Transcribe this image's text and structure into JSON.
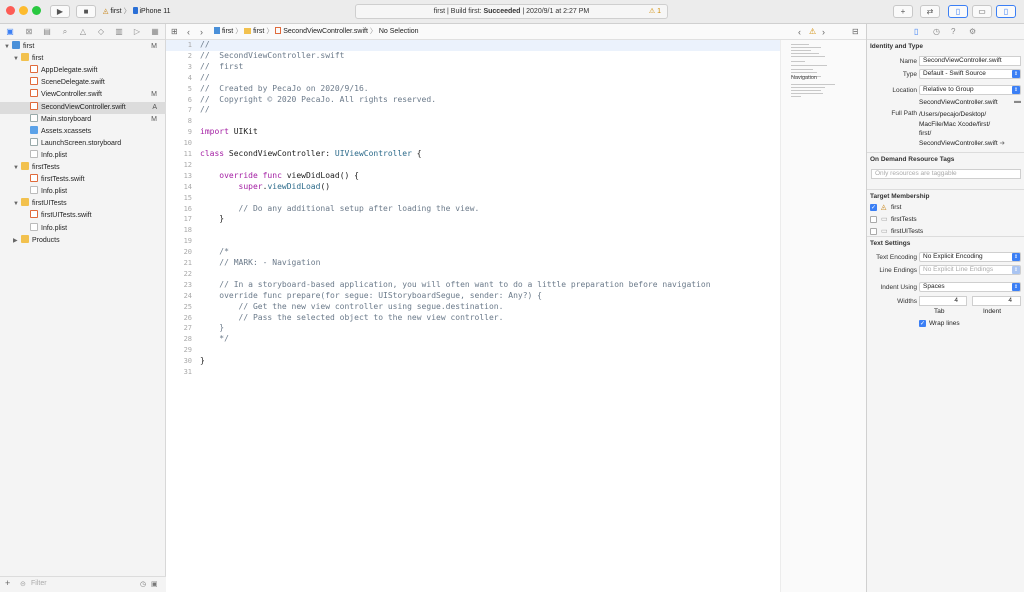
{
  "toolbar": {
    "scheme": "first",
    "device": "iPhone 11",
    "activity": "first | Build first: Succeeded | 2020/9/1 at 2:27 PM",
    "activity_prefix": "first | Build first: ",
    "activity_status": "Succeeded",
    "activity_suffix": " | 2020/9/1 at 2:27 PM",
    "warning_count": "1",
    "colors": {
      "close": "#fd5c55",
      "minimize": "#fdbb2e",
      "zoom": "#29c840",
      "accent": "#3b7ff5"
    }
  },
  "navigator": {
    "tree": [
      {
        "label": "first",
        "icon": "project-icon",
        "level": 0,
        "badge": "M",
        "disclosure": "open"
      },
      {
        "label": "first",
        "icon": "folder-icon",
        "level": 1,
        "badge": "",
        "disclosure": "open"
      },
      {
        "label": "AppDelegate.swift",
        "icon": "swift-file-icon",
        "level": 2,
        "badge": ""
      },
      {
        "label": "SceneDelegate.swift",
        "icon": "swift-file-icon",
        "level": 2,
        "badge": ""
      },
      {
        "label": "ViewController.swift",
        "icon": "swift-file-icon",
        "level": 2,
        "badge": "M"
      },
      {
        "label": "SecondViewController.swift",
        "icon": "swift-file-icon",
        "level": 2,
        "badge": "A",
        "selected": true
      },
      {
        "label": "Main.storyboard",
        "icon": "storyboard-icon",
        "level": 2,
        "badge": "M"
      },
      {
        "label": "Assets.xcassets",
        "icon": "assets-icon",
        "level": 2,
        "badge": ""
      },
      {
        "label": "LaunchScreen.storyboard",
        "icon": "storyboard-icon",
        "level": 2,
        "badge": ""
      },
      {
        "label": "Info.plist",
        "icon": "plist-icon",
        "level": 2,
        "badge": ""
      },
      {
        "label": "firstTests",
        "icon": "folder-icon",
        "level": 1,
        "badge": "",
        "disclosure": "open"
      },
      {
        "label": "firstTests.swift",
        "icon": "swift-file-icon",
        "level": 2,
        "badge": ""
      },
      {
        "label": "Info.plist",
        "icon": "plist-icon",
        "level": 2,
        "badge": ""
      },
      {
        "label": "firstUITests",
        "icon": "folder-icon",
        "level": 1,
        "badge": "",
        "disclosure": "open"
      },
      {
        "label": "firstUITests.swift",
        "icon": "swift-file-icon",
        "level": 2,
        "badge": ""
      },
      {
        "label": "Info.plist",
        "icon": "plist-icon",
        "level": 2,
        "badge": ""
      },
      {
        "label": "Products",
        "icon": "folder-icon",
        "level": 1,
        "badge": "",
        "disclosure": "closed"
      }
    ],
    "filter_placeholder": "Filter"
  },
  "editor": {
    "breadcrumb": [
      "first",
      "first",
      "SecondViewController.swift",
      "No Selection"
    ],
    "lines": [
      {
        "n": "1",
        "segs": [
          {
            "t": "//",
            "c": "c"
          }
        ]
      },
      {
        "n": "2",
        "segs": [
          {
            "t": "//  SecondViewController.swift",
            "c": "c"
          }
        ]
      },
      {
        "n": "3",
        "segs": [
          {
            "t": "//  first",
            "c": "c"
          }
        ]
      },
      {
        "n": "4",
        "segs": [
          {
            "t": "//",
            "c": "c"
          }
        ]
      },
      {
        "n": "5",
        "segs": [
          {
            "t": "//  Created by PecaJo on 2020/9/16.",
            "c": "c"
          }
        ]
      },
      {
        "n": "6",
        "segs": [
          {
            "t": "//  Copyright © 2020 PecaJo. All rights reserved.",
            "c": "c"
          }
        ]
      },
      {
        "n": "7",
        "segs": [
          {
            "t": "//",
            "c": "c"
          }
        ]
      },
      {
        "n": "8",
        "segs": []
      },
      {
        "n": "9",
        "segs": [
          {
            "t": "import",
            "c": "k"
          },
          {
            "t": " UIKit",
            "c": ""
          }
        ]
      },
      {
        "n": "10",
        "segs": []
      },
      {
        "n": "11",
        "segs": [
          {
            "t": "class",
            "c": "k"
          },
          {
            "t": " SecondViewController: ",
            "c": ""
          },
          {
            "t": "UIViewController",
            "c": "t"
          },
          {
            "t": " {",
            "c": ""
          }
        ]
      },
      {
        "n": "12",
        "segs": []
      },
      {
        "n": "13",
        "segs": [
          {
            "t": "    ",
            "c": ""
          },
          {
            "t": "override func",
            "c": "k"
          },
          {
            "t": " viewDidLoad() {",
            "c": ""
          }
        ]
      },
      {
        "n": "14",
        "segs": [
          {
            "t": "        ",
            "c": ""
          },
          {
            "t": "super",
            "c": "k"
          },
          {
            "t": ".",
            "c": ""
          },
          {
            "t": "viewDidLoad",
            "c": "t"
          },
          {
            "t": "()",
            "c": ""
          }
        ]
      },
      {
        "n": "15",
        "segs": []
      },
      {
        "n": "16",
        "segs": [
          {
            "t": "        // Do any additional setup after loading the view.",
            "c": "c"
          }
        ]
      },
      {
        "n": "17",
        "segs": [
          {
            "t": "    }",
            "c": ""
          }
        ]
      },
      {
        "n": "18",
        "segs": []
      },
      {
        "n": "19",
        "segs": []
      },
      {
        "n": "20",
        "segs": [
          {
            "t": "    /*",
            "c": "c"
          }
        ]
      },
      {
        "n": "21",
        "segs": [
          {
            "t": "    // MARK: - Navigation",
            "c": "c"
          }
        ]
      },
      {
        "n": "22",
        "segs": []
      },
      {
        "n": "23",
        "segs": [
          {
            "t": "    // In a storyboard-based application, you will often want to do a little preparation before navigation",
            "c": "c"
          }
        ]
      },
      {
        "n": "24",
        "segs": [
          {
            "t": "    override func prepare(for segue: UIStoryboardSegue, sender: Any?) {",
            "c": "c"
          }
        ]
      },
      {
        "n": "25",
        "segs": [
          {
            "t": "        // Get the new view controller using segue.destination.",
            "c": "c"
          }
        ]
      },
      {
        "n": "26",
        "segs": [
          {
            "t": "        // Pass the selected object to the new view controller.",
            "c": "c"
          }
        ]
      },
      {
        "n": "27",
        "segs": [
          {
            "t": "    }",
            "c": "c"
          }
        ]
      },
      {
        "n": "28",
        "segs": [
          {
            "t": "    */",
            "c": "c"
          }
        ]
      },
      {
        "n": "29",
        "segs": []
      },
      {
        "n": "30",
        "segs": [
          {
            "t": "}",
            "c": ""
          }
        ]
      },
      {
        "n": "31",
        "segs": []
      }
    ],
    "minimap_label": "Navigation"
  },
  "inspector": {
    "identity": {
      "title": "Identity and Type",
      "name_label": "Name",
      "name_value": "SecondViewController.swift",
      "type_label": "Type",
      "type_value": "Default - Swift Source",
      "location_label": "Location",
      "location_value": "Relative to Group",
      "location_file": "SecondViewController.swift",
      "fullpath_label": "Full Path",
      "fullpath_lines": [
        "/Users/pecajo/Desktop/",
        "MacFile/Mac Xcode/first/",
        "first/",
        "SecondViewController.swift"
      ]
    },
    "odr": {
      "title": "On Demand Resource Tags",
      "placeholder": "Only resources are taggable"
    },
    "membership": {
      "title": "Target Membership",
      "targets": [
        {
          "label": "first",
          "checked": true
        },
        {
          "label": "firstTests",
          "checked": false
        },
        {
          "label": "firstUITests",
          "checked": false
        }
      ]
    },
    "text_settings": {
      "title": "Text Settings",
      "encoding_label": "Text Encoding",
      "encoding_value": "No Explicit Encoding",
      "line_endings_label": "Line Endings",
      "line_endings_value": "No Explicit Line Endings",
      "indent_label": "Indent Using",
      "indent_value": "Spaces",
      "widths_label": "Widths",
      "tab_value": "4",
      "indent_width_value": "4",
      "tab_caption": "Tab",
      "indent_caption": "Indent",
      "wrap_label": "Wrap lines",
      "wrap_checked": true
    }
  }
}
